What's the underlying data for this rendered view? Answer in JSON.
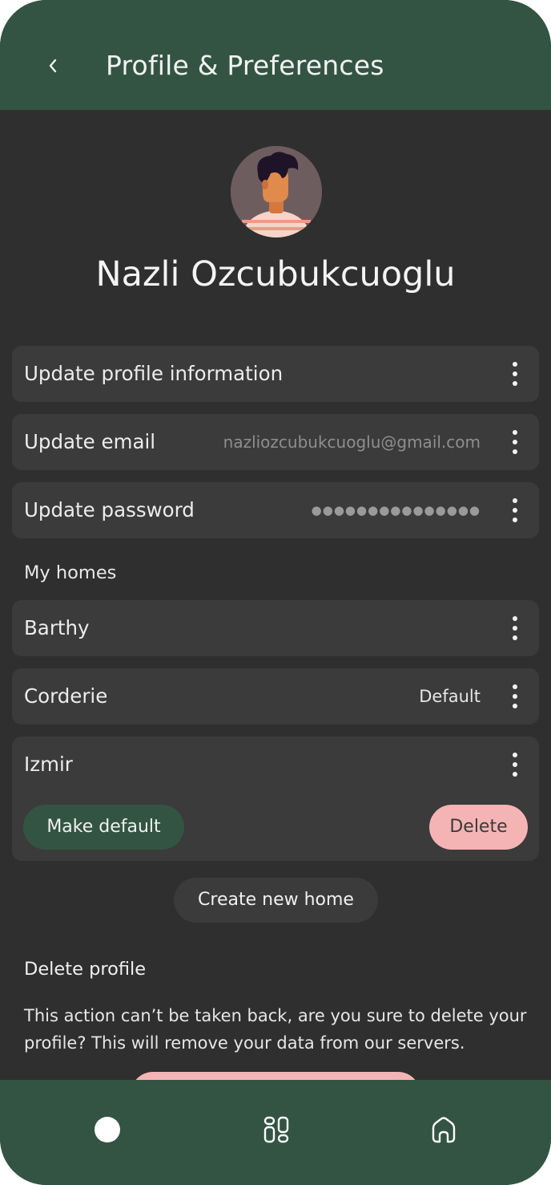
{
  "header": {
    "title": "Profile & Preferences",
    "back_icon": "chevron-left-icon"
  },
  "profile": {
    "name": "Nazli Ozcubukcuoglu",
    "avatar": "avatar-illustration"
  },
  "account_rows": [
    {
      "label": "Update profile information",
      "value": ""
    },
    {
      "label": "Update email",
      "value": "nazliozcubukcuoglu@gmail.com"
    },
    {
      "label": "Update password",
      "value": "●●●●●●●●●●●●●●●"
    }
  ],
  "homes": {
    "section_label": "My homes",
    "items": [
      {
        "name": "Barthy",
        "badge": ""
      },
      {
        "name": "Corderie",
        "badge": "Default"
      },
      {
        "name": "Izmir",
        "badge": ""
      }
    ],
    "make_default_label": "Make default",
    "delete_label": "Delete",
    "create_label": "Create new home"
  },
  "delete_profile": {
    "heading": "Delete profile",
    "description": "This action can’t be taken back, are you sure to delete your profile? This will remove your data from our servers."
  },
  "nav": {
    "items": [
      "home-dot-icon",
      "dashboard-icon",
      "house-icon"
    ]
  },
  "colors": {
    "accent_green": "#335443",
    "background": "#2f2f2f",
    "row_background": "#3b3b3b",
    "danger_pink": "#f5b4b4"
  }
}
